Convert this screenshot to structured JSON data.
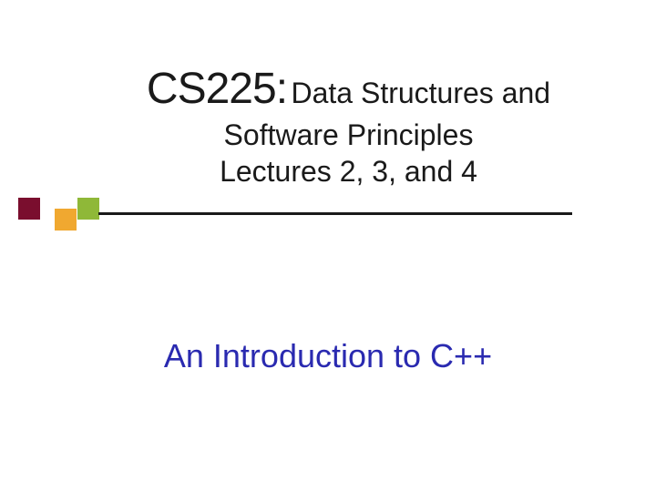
{
  "title": {
    "course_code": "CS225:",
    "course_name_part1": "Data Structures and",
    "course_name_part2": "Software Principles",
    "lectures": "Lectures 2, 3, and 4"
  },
  "subtitle": "An Introduction to C++",
  "colors": {
    "text": "#1a1a1a",
    "subtitle": "#2a2ab0",
    "accent_dark": "#7a0e2e",
    "accent_gold": "#f0a830",
    "accent_green": "#8fb838"
  }
}
